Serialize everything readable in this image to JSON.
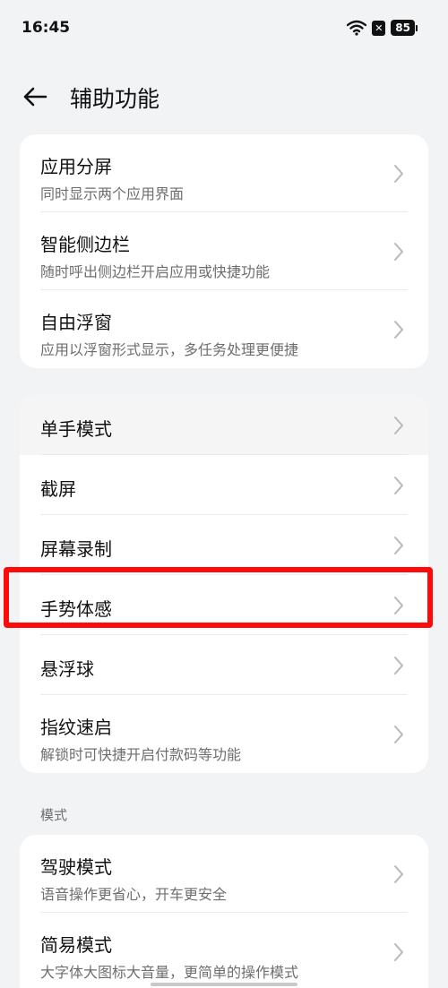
{
  "status_bar": {
    "time": "16:45",
    "battery": "85",
    "icons": [
      "wifi-icon",
      "sim-x-icon",
      "battery-icon"
    ]
  },
  "header": {
    "title": "辅助功能",
    "back_icon": "arrow-left-icon"
  },
  "group1": [
    {
      "title": "应用分屏",
      "subtitle": "同时显示两个应用界面"
    },
    {
      "title": "智能侧边栏",
      "subtitle": "随时呼出侧边栏开启应用或快捷功能"
    },
    {
      "title": "自由浮窗",
      "subtitle": "应用以浮窗形式显示，多任务处理更便捷"
    }
  ],
  "group2": [
    {
      "title": "单手模式"
    },
    {
      "title": "截屏"
    },
    {
      "title": "屏幕录制"
    },
    {
      "title": "手势体感"
    },
    {
      "title": "悬浮球"
    },
    {
      "title": "指纹速启",
      "subtitle": "解锁时可快捷开启付款码等功能"
    }
  ],
  "section_label": "模式",
  "group3": [
    {
      "title": "驾驶模式",
      "subtitle": "语音操作更省心，开车更安全"
    },
    {
      "title": "简易模式",
      "subtitle": "大字体大图标大音量，更简单的操作模式"
    }
  ],
  "colors": {
    "background": "#f2f3f5",
    "card": "#ffffff",
    "highlight": "#ff0a0a",
    "subtitle": "#6e6e6e"
  }
}
